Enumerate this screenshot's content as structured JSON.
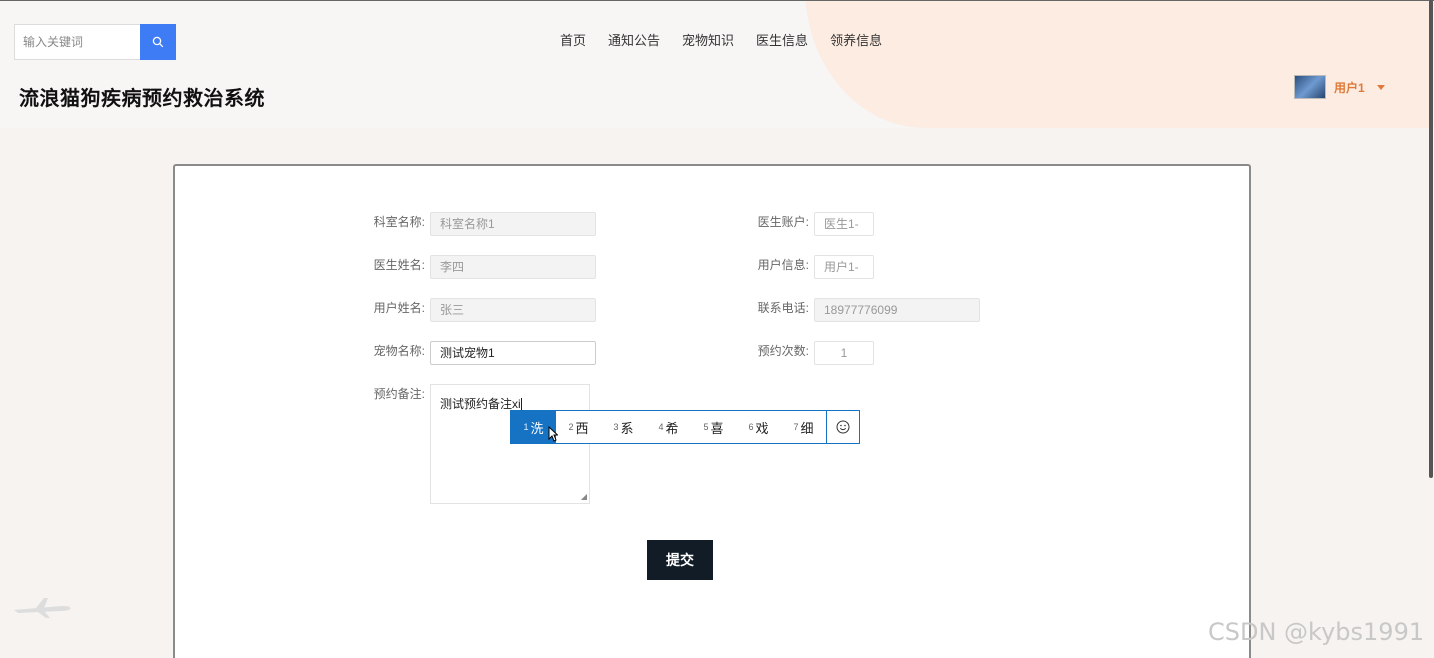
{
  "search": {
    "placeholder": "输入关键词"
  },
  "nav": {
    "items": [
      "首页",
      "通知公告",
      "宠物知识",
      "医生信息",
      "领养信息"
    ]
  },
  "site": {
    "title": "流浪猫狗疾病预约救治系统"
  },
  "user": {
    "name": "用户1"
  },
  "form": {
    "fields": {
      "keshi_label": "科室名称:",
      "keshi_value": "科室名称1",
      "yisheng_zh_label": "医生账户:",
      "yisheng_zh_value": "医生1-",
      "yisheng_name_label": "医生姓名:",
      "yisheng_name_value": "李四",
      "yonghu_info_label": "用户信息:",
      "yonghu_info_value": "用户1-",
      "yonghu_name_label": "用户姓名:",
      "yonghu_name_value": "张三",
      "phone_label": "联系电话:",
      "phone_value": "18977776099",
      "pet_label": "宠物名称:",
      "pet_value": "测试宠物1",
      "count_label": "预约次数:",
      "count_value": "1",
      "remark_label": "预约备注:",
      "remark_value": "测试预约备注xi"
    },
    "submit_label": "提交"
  },
  "ime": {
    "candidates": [
      {
        "num": "1",
        "text": "洗"
      },
      {
        "num": "2",
        "text": "西"
      },
      {
        "num": "3",
        "text": "系"
      },
      {
        "num": "4",
        "text": "希"
      },
      {
        "num": "5",
        "text": "喜"
      },
      {
        "num": "6",
        "text": "戏"
      },
      {
        "num": "7",
        "text": "细"
      }
    ],
    "selected_index": 0
  },
  "watermark": "CSDN @kybs1991",
  "colors": {
    "accent_blue": "#3d7cf5",
    "ime_blue": "#1673c4",
    "user_orange": "#e07a3a",
    "submit_dark": "#111c26"
  }
}
